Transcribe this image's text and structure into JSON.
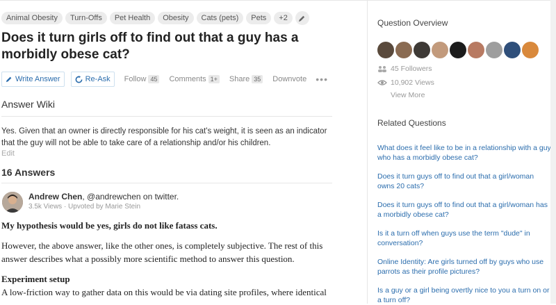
{
  "tags": [
    "Animal Obesity",
    "Turn-Offs",
    "Pet Health",
    "Obesity",
    "Cats (pets)",
    "Pets",
    "+2"
  ],
  "question": {
    "title": "Does it turn girls off to find out that a guy has a morbidly obese cat?"
  },
  "actions": {
    "write_answer": "Write Answer",
    "re_ask": "Re-Ask",
    "follow": "Follow",
    "follow_count": "45",
    "comments": "Comments",
    "comments_count": "1+",
    "share": "Share",
    "share_count": "35",
    "downvote": "Downvote",
    "more": "•••"
  },
  "wiki": {
    "heading": "Answer Wiki",
    "text": "Yes.  Given that an owner is directly responsible for his cat's weight, it is seen as an indicator that the guy will not be able to take care of a relationship and/or his children.",
    "edit": "Edit"
  },
  "answers": {
    "heading": "16 Answers",
    "author_name": "Andrew Chen",
    "author_handle": ", @andrewchen on twitter.",
    "author_meta": "3.5k Views · Upvoted by Marie Stein",
    "bold_line": "My hypothesis would be yes, girls do not like fatass cats.",
    "para1": "However, the above answer, like the other ones, is completely subjective. The rest of this answer describes what a possibly more scientific method to answer this question.",
    "sub_heading": "Experiment setup",
    "para2": "A low-friction way to gather data on this would be via dating site profiles, where identical"
  },
  "sidebar": {
    "overview_heading": "Question Overview",
    "followers": "45 Followers",
    "views": "10,902 Views",
    "view_more": "View More",
    "related_heading": "Related Questions",
    "related": [
      "What does it feel like to be in a relationship with a guy who has a morbidly obese cat?",
      "Does it turn guys off to find out that a girl/woman owns 20 cats?",
      "Does it turn guys off to find out that a girl/woman has a morbidly obese cat?",
      "Is it a turn off when guys use the term \"dude\" in conversation?",
      "Online Identity: Are girls turned off by guys who use parrots as their profile pictures?",
      "Is a guy or a girl being overtly nice to you a turn on or a turn off?"
    ]
  },
  "colors": {
    "link": "#2b6dad",
    "tag_bg": "#ececec",
    "text": "#333333"
  }
}
